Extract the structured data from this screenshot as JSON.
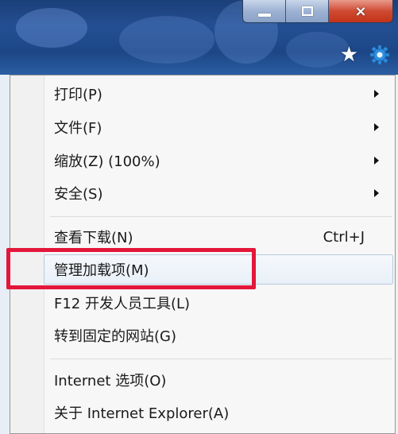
{
  "window": {
    "caption": {
      "minimize": "minimize-icon",
      "maximize": "maximize-icon",
      "close": "×"
    },
    "toolbar_icons": [
      "star-icon",
      "gear-icon"
    ],
    "accent_color": "#e3173a"
  },
  "menu": {
    "items": [
      {
        "label": "打印(P)",
        "has_submenu": true
      },
      {
        "label": "文件(F)",
        "has_submenu": true
      },
      {
        "label": "缩放(Z) (100%)",
        "has_submenu": true
      },
      {
        "label": "安全(S)",
        "has_submenu": true
      },
      {
        "label": "查看下载(N)",
        "shortcut": "Ctrl+J"
      },
      {
        "label": "管理加载项(M)",
        "highlighted": true
      },
      {
        "label": "F12 开发人员工具(L)"
      },
      {
        "label": "转到固定的网站(G)"
      },
      {
        "label": "Internet 选项(O)"
      },
      {
        "label": "关于 Internet Explorer(A)"
      }
    ]
  }
}
